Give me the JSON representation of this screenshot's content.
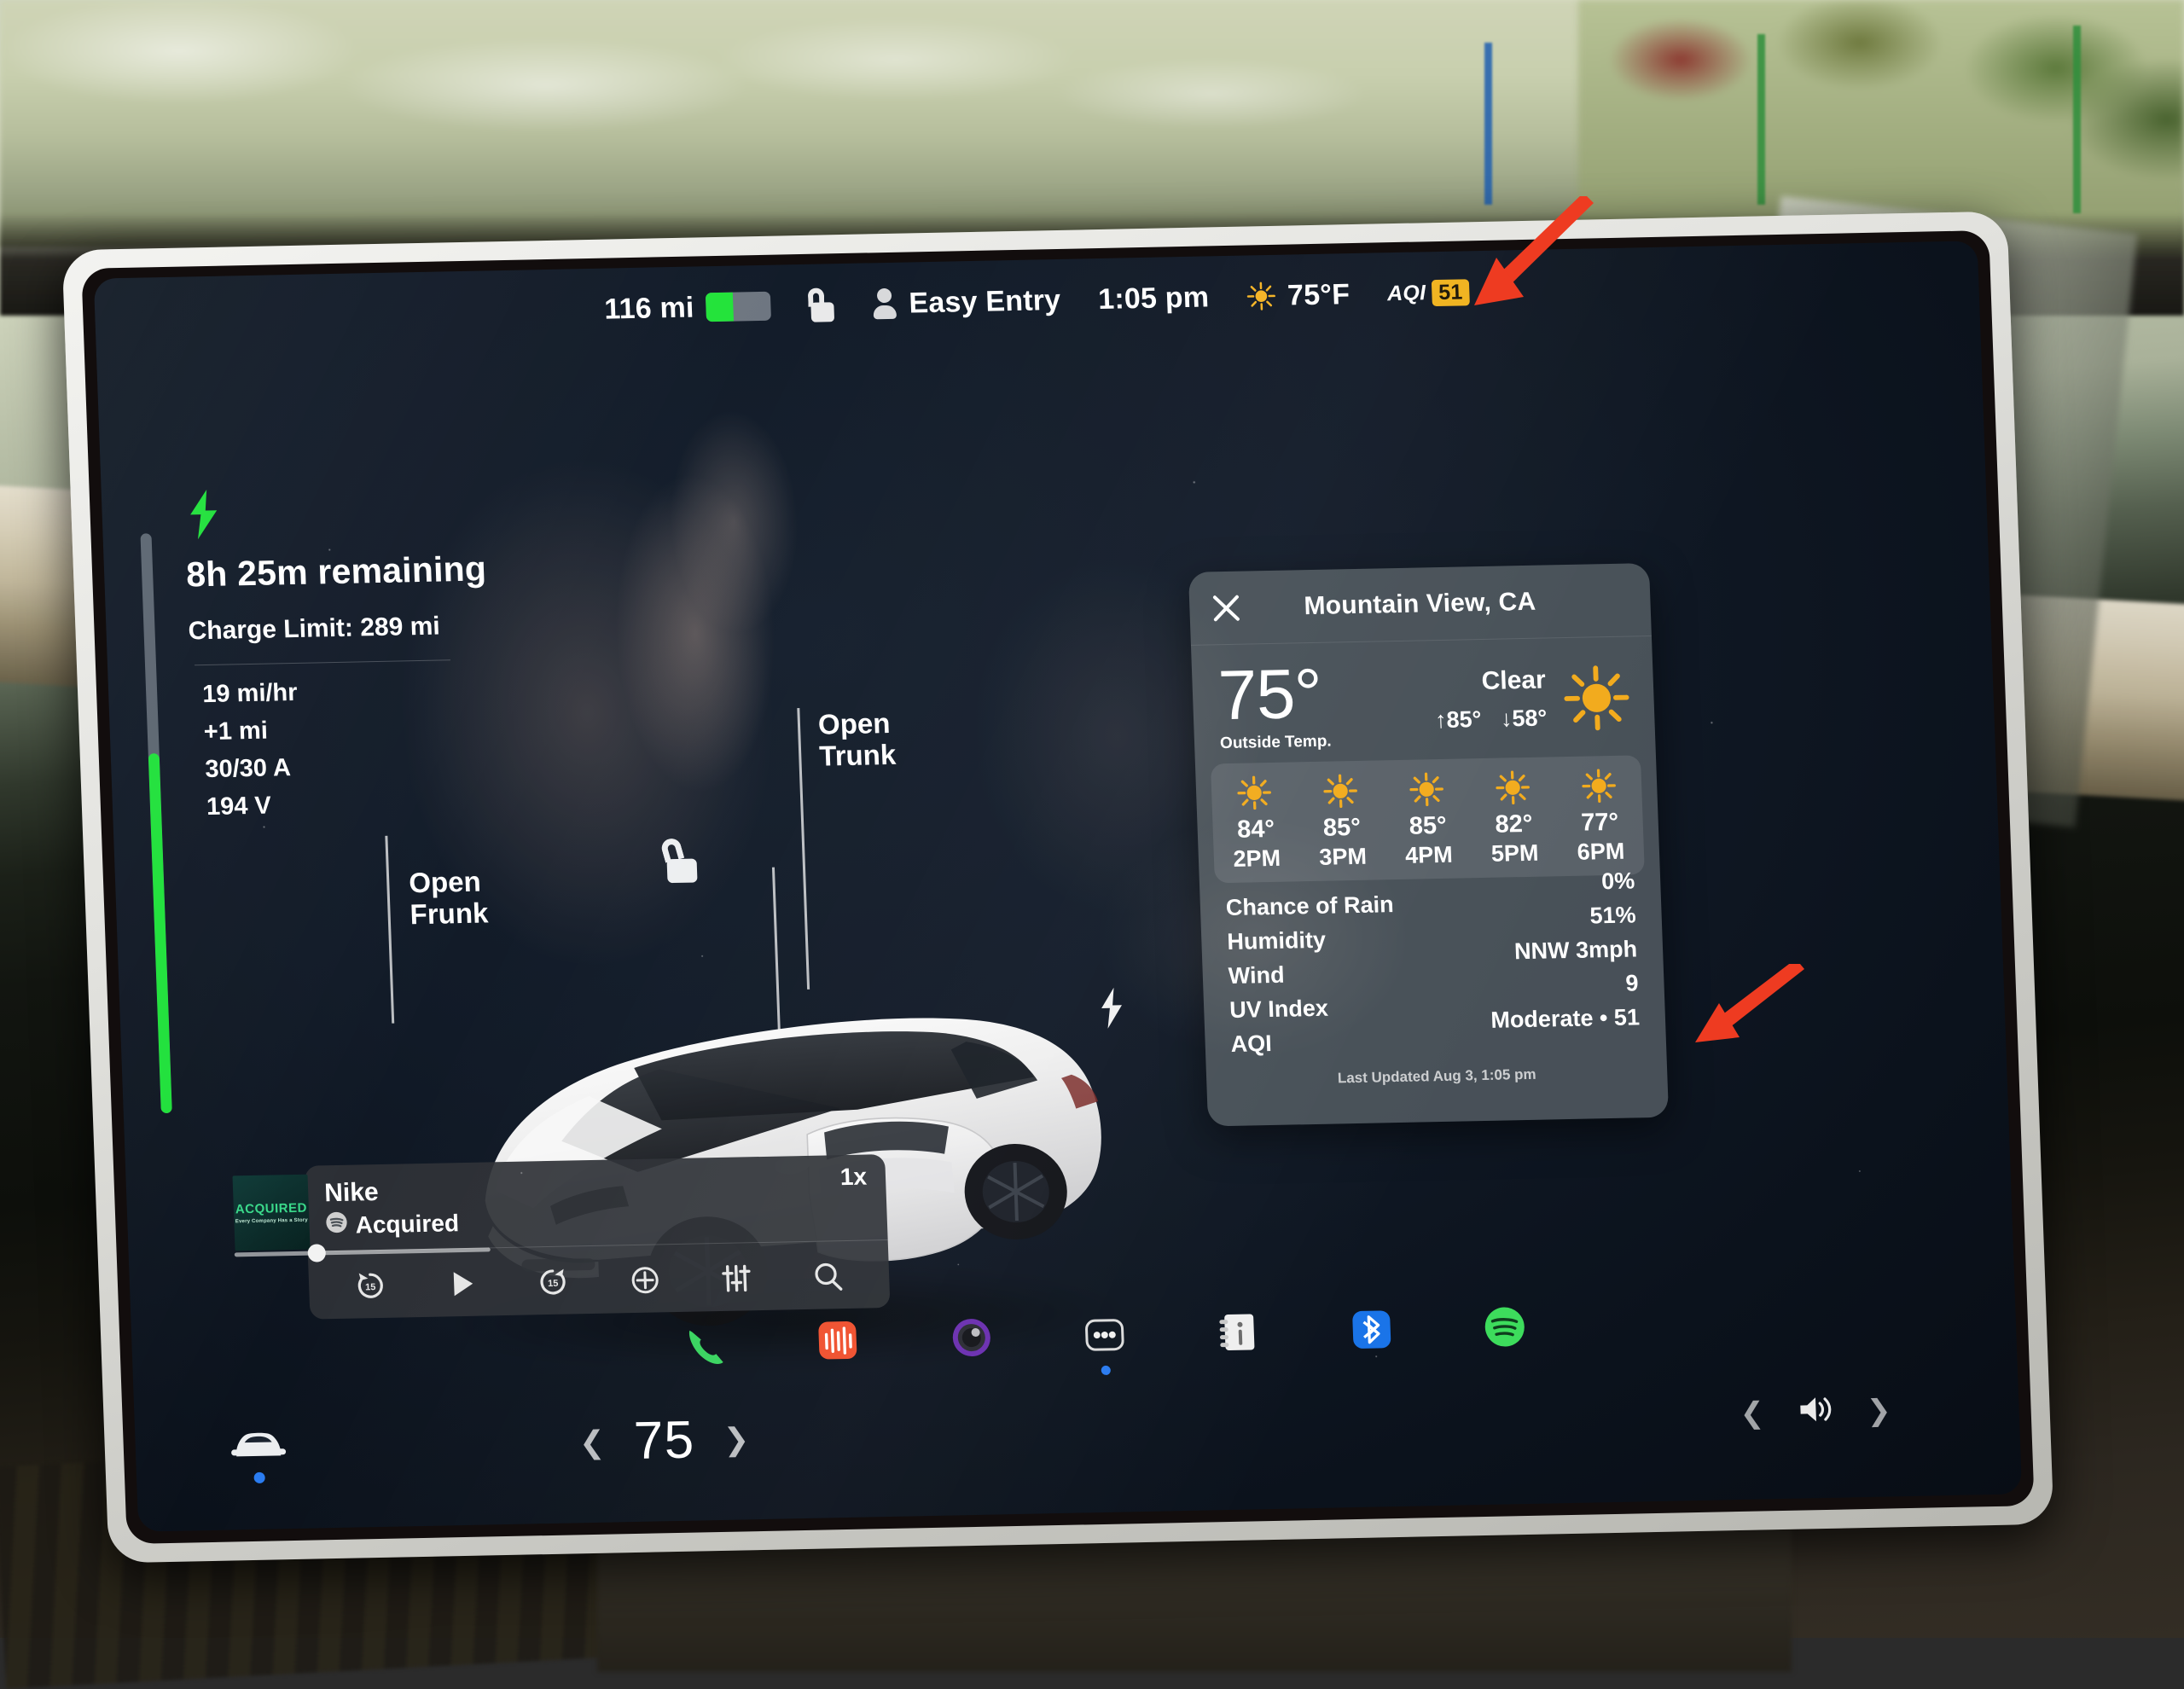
{
  "statusbar": {
    "range": "116 mi",
    "battery_percent": 42,
    "lock_icon": "unlocked-padlock-icon",
    "profile_icon": "person-icon",
    "profile_name": "Easy Entry",
    "time": "1:05 pm",
    "weather_icon": "sun-icon",
    "outside_temp": "75°F",
    "aqi_label": "AQI",
    "aqi_value": "51",
    "aqi_color": "#f0b21c"
  },
  "charging": {
    "bolt_icon": "lightning-bolt-icon",
    "bolt_color": "#1fe03a",
    "time_remaining": "8h 25m remaining",
    "charge_limit": "Charge Limit: 289 mi",
    "stats": [
      "19 mi/hr",
      "+1 mi",
      "30/30 A",
      "194 V"
    ],
    "bar_fill_percent": 62
  },
  "car": {
    "open_frunk_label": "Open\nFrunk",
    "open_frunk_line1": "Open",
    "open_frunk_line2": "Frunk",
    "open_trunk_line1": "Open",
    "open_trunk_line2": "Trunk",
    "unlock_icon": "unlocked-padlock-icon",
    "charge_port_icon": "lightning-bolt-icon",
    "model": "white-tesla-model-y"
  },
  "weather": {
    "close_icon": "close-x-icon",
    "location": "Mountain View, CA",
    "temperature": "75°",
    "temperature_label": "Outside Temp.",
    "condition": "Clear",
    "condition_icon": "sun-icon",
    "high": "↑85°",
    "low": "↓58°",
    "hourly": [
      {
        "icon": "sun-icon",
        "temp": "84°",
        "hour": "2PM"
      },
      {
        "icon": "sun-icon",
        "temp": "85°",
        "hour": "3PM"
      },
      {
        "icon": "sun-icon",
        "temp": "85°",
        "hour": "4PM"
      },
      {
        "icon": "sun-icon",
        "temp": "82°",
        "hour": "5PM"
      },
      {
        "icon": "sun-icon",
        "temp": "77°",
        "hour": "6PM"
      }
    ],
    "details": [
      {
        "label": "Chance of Rain",
        "value": "0%"
      },
      {
        "label": "Humidity",
        "value": "51%"
      },
      {
        "label": "Wind",
        "value": "NNW 3mph"
      },
      {
        "label": "UV Index",
        "value": "9"
      },
      {
        "label": "AQI",
        "value": "Moderate • 51"
      }
    ],
    "last_updated": "Last Updated Aug 3, 1:05 pm"
  },
  "media": {
    "artwork_brand": "ACQUIRED",
    "artwork_tagline": "Every Company Has a Story",
    "title": "Nike",
    "source_icon": "spotify-icon",
    "source": "Acquired",
    "speed": "1x",
    "controls": [
      "rewind-15-icon",
      "play-icon",
      "forward-15-icon",
      "add-icon",
      "equalizer-icon",
      "search-icon"
    ]
  },
  "dock": {
    "items": [
      {
        "icon": "phone-icon",
        "color": "#38d45f"
      },
      {
        "icon": "audio-waveform-icon",
        "color": "#f0502e"
      },
      {
        "icon": "dashcam-lens-icon",
        "color": "#8a3fd4"
      },
      {
        "icon": "more-dots-icon",
        "color": "#ffffff"
      },
      {
        "icon": "notes-card-icon",
        "color": "#efefef"
      },
      {
        "icon": "bluetooth-icon",
        "color": "#1a74e8"
      },
      {
        "icon": "spotify-icon",
        "color": "#3ddc5c"
      }
    ]
  },
  "climate": {
    "car_icon": "car-front-icon",
    "prev_icon": "chevron-left-icon",
    "temperature": "75",
    "next_icon": "chevron-right-icon"
  },
  "volume": {
    "prev_icon": "chevron-left-icon",
    "speaker_icon": "speaker-volume-icon",
    "next_icon": "chevron-right-icon"
  },
  "annotations": {
    "arrow_color": "#ee3b21",
    "arrow_1_target": "aqi-status-badge",
    "arrow_2_target": "weather-aqi-row"
  }
}
